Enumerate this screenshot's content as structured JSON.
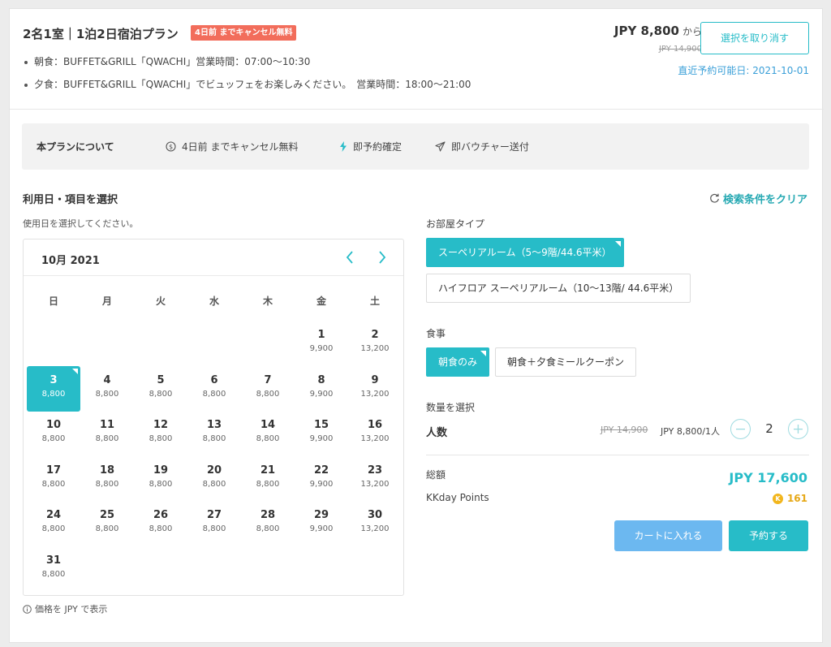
{
  "header": {
    "title": "2名1室｜1泊2日宿泊プラン",
    "cancel_badge": "4日前 までキャンセル無料",
    "meal_lines": [
      "朝食：BUFFET&GRILL「QWACHI」営業時間：07:00〜10:30",
      "夕食：BUFFET&GRILL「QWACHI」でビュッフェをお楽しみください。　営業時間：18:00〜21:00"
    ],
    "price": "JPY 8,800",
    "price_suffix": "から",
    "original_price": "JPY 14,900",
    "deselect_label": "選択を取り消す",
    "nearest_date": "直近予約可能日: 2021-10-01"
  },
  "about": {
    "title": "本プランについて",
    "items": [
      "4日前 までキャンセル無料",
      "即予約確定",
      "即バウチャー送付"
    ]
  },
  "selection": {
    "title": "利用日・項目を選択",
    "clear_label": "検索条件をクリア",
    "date_hint": "使用日を選択してください。",
    "price_note": "価格を JPY で表示"
  },
  "calendar": {
    "month_label": "10月 2021",
    "weekdays": [
      "日",
      "月",
      "火",
      "水",
      "木",
      "金",
      "土"
    ],
    "first_weekday": 5,
    "selected_day": 3,
    "days": [
      {
        "d": "1",
        "p": "9,900"
      },
      {
        "d": "2",
        "p": "13,200"
      },
      {
        "d": "3",
        "p": "8,800"
      },
      {
        "d": "4",
        "p": "8,800"
      },
      {
        "d": "5",
        "p": "8,800"
      },
      {
        "d": "6",
        "p": "8,800"
      },
      {
        "d": "7",
        "p": "8,800"
      },
      {
        "d": "8",
        "p": "9,900"
      },
      {
        "d": "9",
        "p": "13,200"
      },
      {
        "d": "10",
        "p": "8,800"
      },
      {
        "d": "11",
        "p": "8,800"
      },
      {
        "d": "12",
        "p": "8,800"
      },
      {
        "d": "13",
        "p": "8,800"
      },
      {
        "d": "14",
        "p": "8,800"
      },
      {
        "d": "15",
        "p": "9,900"
      },
      {
        "d": "16",
        "p": "13,200"
      },
      {
        "d": "17",
        "p": "8,800"
      },
      {
        "d": "18",
        "p": "8,800"
      },
      {
        "d": "19",
        "p": "8,800"
      },
      {
        "d": "20",
        "p": "8,800"
      },
      {
        "d": "21",
        "p": "8,800"
      },
      {
        "d": "22",
        "p": "9,900"
      },
      {
        "d": "23",
        "p": "13,200"
      },
      {
        "d": "24",
        "p": "8,800"
      },
      {
        "d": "25",
        "p": "8,800"
      },
      {
        "d": "26",
        "p": "8,800"
      },
      {
        "d": "27",
        "p": "8,800"
      },
      {
        "d": "28",
        "p": "8,800"
      },
      {
        "d": "29",
        "p": "9,900"
      },
      {
        "d": "30",
        "p": "13,200"
      },
      {
        "d": "31",
        "p": "8,800"
      }
    ]
  },
  "options": {
    "room_label": "お部屋タイプ",
    "rooms": [
      "スーペリアルーム（5〜9階/44.6平米）",
      "ハイフロア スーペリアルーム（10〜13階/ 44.6平米）"
    ],
    "room_selected": 0,
    "meal_label": "食事",
    "meals": [
      "朝食のみ",
      "朝食＋夕食ミールクーポン"
    ],
    "meal_selected": 0
  },
  "quantity": {
    "section_label": "数量を選択",
    "label": "人数",
    "original_price": "JPY 14,900",
    "unit_price": "JPY 8,800/1人",
    "value": "2"
  },
  "summary": {
    "total_label": "総額",
    "total_value": "JPY 17,600",
    "points_label": "KKday Points",
    "points_value": "161"
  },
  "actions": {
    "cart_label": "カートに入れる",
    "book_label": "予約する"
  },
  "colors": {
    "accent": "#27bcc8",
    "badge": "#f26d5b",
    "cart_button": "#6cb8f0",
    "points": "#e6a817"
  }
}
